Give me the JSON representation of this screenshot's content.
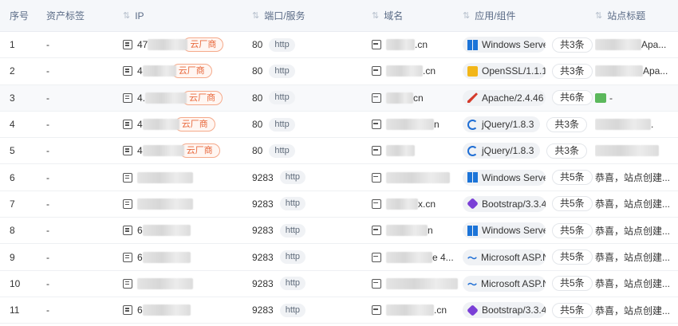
{
  "columns": {
    "index": "序号",
    "asset_tag": "资产标签",
    "ip": "IP",
    "port_service": "端口/服务",
    "domain": "域名",
    "app_component": "应用/组件",
    "site_title": "站点标题"
  },
  "rows": [
    {
      "index": "1",
      "tag": "-",
      "ip": "47",
      "cloud": "云厂商",
      "port": "80",
      "proto": "http",
      "domain": ".cn",
      "app": "Windows Server",
      "app_icon": "windows-icon",
      "count": "共3条",
      "title": "Apa..."
    },
    {
      "index": "2",
      "tag": "-",
      "ip": "4",
      "cloud": "云厂商",
      "port": "80",
      "proto": "http",
      "domain": ".cn",
      "app": "OpenSSL/1.1.1g",
      "app_icon": "lock-icon",
      "count": "共3条",
      "title": "Apa..."
    },
    {
      "index": "3",
      "tag": "-",
      "ip": "4.",
      "cloud": "云厂商",
      "port": "80",
      "proto": "http",
      "domain": "cn",
      "app": "Apache/2.4.46",
      "app_icon": "apache-feather-icon",
      "count": "共6条",
      "title": "-"
    },
    {
      "index": "4",
      "tag": "-",
      "ip": "4",
      "cloud": "云厂商",
      "port": "80",
      "proto": "http",
      "domain": "n",
      "app": "jQuery/1.8.3",
      "app_icon": "jquery-icon",
      "count": "共3条",
      "title": "."
    },
    {
      "index": "5",
      "tag": "-",
      "ip": "4",
      "cloud": "云厂商",
      "port": "80",
      "proto": "http",
      "domain": "",
      "app": "jQuery/1.8.3",
      "app_icon": "jquery-icon",
      "count": "共3条",
      "title": ""
    },
    {
      "index": "6",
      "tag": "-",
      "ip": "",
      "cloud": "",
      "port": "9283",
      "proto": "http",
      "domain": "",
      "app": "Windows Server",
      "app_icon": "windows-icon",
      "count": "共5条",
      "title": "恭喜，站点创建..."
    },
    {
      "index": "7",
      "tag": "-",
      "ip": "",
      "cloud": "",
      "port": "9283",
      "proto": "http",
      "domain": "x.cn",
      "app": "Bootstrap/3.3.4",
      "app_icon": "bootstrap-icon",
      "count": "共5条",
      "title": "恭喜，站点创建..."
    },
    {
      "index": "8",
      "tag": "-",
      "ip": "6",
      "cloud": "",
      "port": "9283",
      "proto": "http",
      "domain": "n",
      "app": "Windows Server",
      "app_icon": "windows-icon",
      "count": "共5条",
      "title": "恭喜，站点创建..."
    },
    {
      "index": "9",
      "tag": "-",
      "ip": "6",
      "cloud": "",
      "port": "9283",
      "proto": "http",
      "domain": "e 4...",
      "app": "Microsoft ASP.N...",
      "app_icon": "aspnet-icon",
      "count": "共5条",
      "title": "恭喜，站点创建..."
    },
    {
      "index": "10",
      "tag": "-",
      "ip": "",
      "cloud": "",
      "port": "9283",
      "proto": "http",
      "domain": "",
      "app": "Microsoft ASP.N...",
      "app_icon": "aspnet-icon",
      "count": "共5条",
      "title": "恭喜，站点创建..."
    },
    {
      "index": "11",
      "tag": "-",
      "ip": "6",
      "cloud": "",
      "port": "9283",
      "proto": "http",
      "domain": ".cn",
      "app": "Bootstrap/3.3.4",
      "app_icon": "bootstrap-icon",
      "count": "共5条",
      "title": "恭喜，站点创建..."
    }
  ]
}
